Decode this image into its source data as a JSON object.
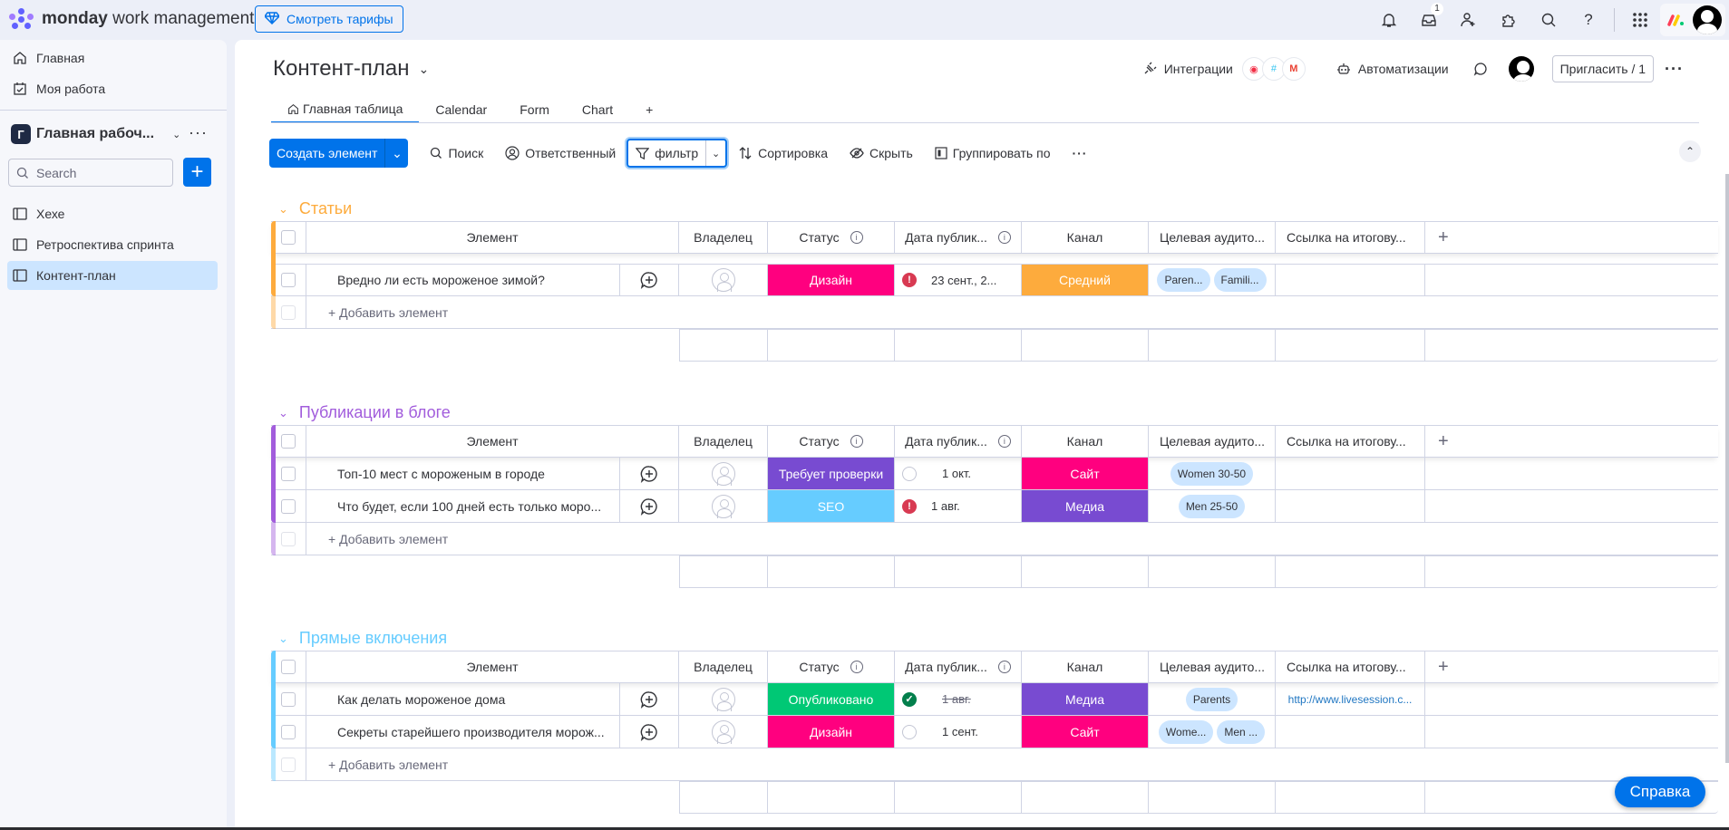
{
  "topbar": {
    "brand_bold": "monday",
    "brand_rest": "work management",
    "pricing_label": "Смотреть тарифы",
    "inbox_badge": "1",
    "icons": [
      "bell-icon",
      "inbox-icon",
      "invite-members-icon",
      "apps-icon",
      "search-icon",
      "help-icon",
      "app-switcher-icon",
      "monday-logo-icon",
      "avatar"
    ]
  },
  "sidebar": {
    "home": "Главная",
    "my_work": "Моя работа",
    "workspace_letter": "Г",
    "workspace_name": "Главная рабоч...",
    "search_placeholder": "Search",
    "boards": [
      {
        "label": "Хехе"
      },
      {
        "label": "Ретроспектива спринта"
      },
      {
        "label": "Контент-план",
        "active": true
      }
    ]
  },
  "board": {
    "title": "Контент-план",
    "tabs": [
      {
        "label": "Главная таблица",
        "active": true
      },
      {
        "label": "Calendar"
      },
      {
        "label": "Form"
      },
      {
        "label": "Chart"
      },
      {
        "label": "+"
      }
    ],
    "integrations_label": "Интеграции",
    "automations_label": "Автоматизации",
    "invite_label": "Пригласить / 1"
  },
  "toolbar": {
    "create_label": "Создать элемент",
    "search_label": "Поиск",
    "person_label": "Ответственный",
    "filter_label": "фильтр",
    "sort_label": "Сортировка",
    "hide_label": "Скрыть",
    "group_label": "Группировать по"
  },
  "columns": {
    "element": "Элемент",
    "owner": "Владелец",
    "status": "Статус",
    "date": "Дата публик...",
    "channel": "Канал",
    "audience": "Целевая аудито...",
    "link": "Ссылка на итогову...",
    "add": "+"
  },
  "add_item_label": "+ Добавить элемент",
  "groups": [
    {
      "title": "Статьи",
      "color": "#fdab3d",
      "rows": [
        {
          "name": "Вредно ли есть мороженое зимой?",
          "status": "Дизайн",
          "status_color": "#ff007f",
          "date_state": "overdue",
          "date": "23 сент., 2...",
          "channel": "Средний",
          "channel_color": "#fdab3d",
          "audience": [
            "Paren...",
            "Famili..."
          ],
          "link": ""
        }
      ]
    },
    {
      "title": "Публикации в блоге",
      "color": "#a25ddc",
      "rows": [
        {
          "name": "Топ-10 мест с мороженым в городе",
          "status": "Требует проверки",
          "status_color": "#784bd1",
          "date_state": "empty",
          "date": "1 окт.",
          "channel": "Сайт",
          "channel_color": "#ff007f",
          "audience": [
            "Women 30-50"
          ],
          "link": ""
        },
        {
          "name": "Что будет, если 100 дней есть только моро...",
          "status": "SEO",
          "status_color": "#66ccff",
          "date_state": "overdue",
          "date": "1 авг.",
          "channel": "Медиа",
          "channel_color": "#784bd1",
          "audience": [
            "Men 25-50"
          ],
          "link": ""
        }
      ]
    },
    {
      "title": "Прямые включения",
      "color": "#66ccff",
      "rows": [
        {
          "name": "Как делать мороженое дома",
          "status": "Опубликовано",
          "status_color": "#00c875",
          "date_state": "done",
          "date": "1 авг.",
          "channel": "Медиа",
          "channel_color": "#784bd1",
          "audience": [
            "Parents"
          ],
          "link": "http://www.livesession.c..."
        },
        {
          "name": "Секреты старейшего производителя морож...",
          "status": "Дизайн",
          "status_color": "#ff007f",
          "date_state": "empty",
          "date": "1 сент.",
          "channel": "Сайт",
          "channel_color": "#ff007f",
          "audience": [
            "Wome...",
            "Men ..."
          ],
          "link": ""
        }
      ]
    }
  ],
  "help_label": "Справка",
  "colors": {
    "accent": "#0073ea"
  }
}
